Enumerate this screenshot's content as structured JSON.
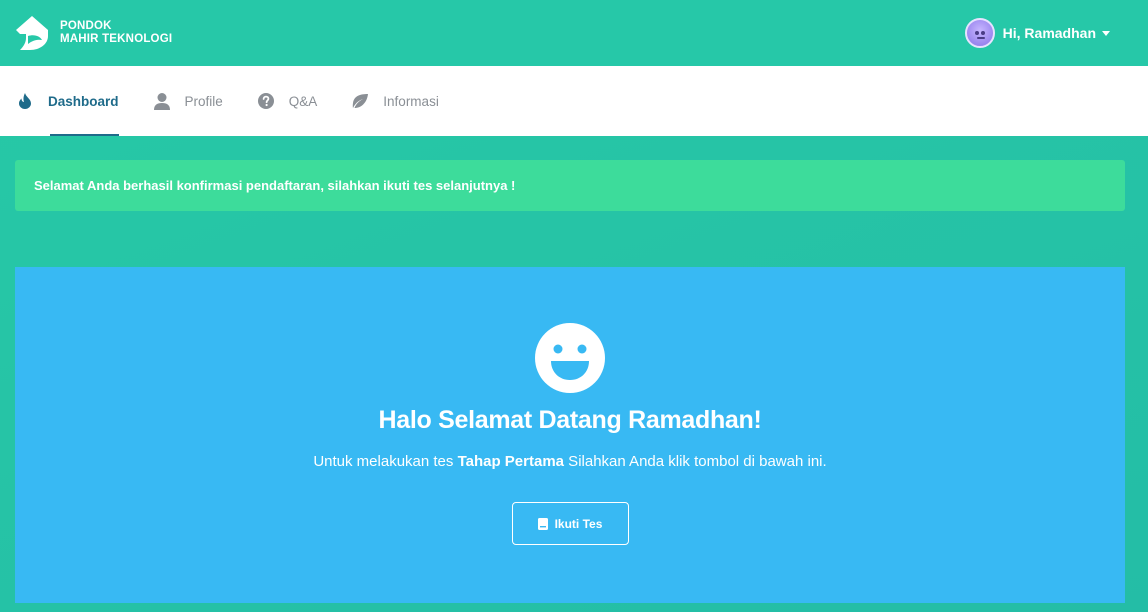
{
  "header": {
    "brand_line1": "PONDOK",
    "brand_line2": "MAHIR TEKNOLOGI",
    "logo_icon": "house-leaf-logo",
    "user_greeting": "Hi, Ramadhan",
    "avatar_icon": "user-avatar"
  },
  "nav": {
    "items": [
      {
        "label": "Dashboard",
        "icon": "fire-icon",
        "active": true
      },
      {
        "label": "Profile",
        "icon": "user-icon",
        "active": false
      },
      {
        "label": "Q&A",
        "icon": "question-circle-icon",
        "active": false
      },
      {
        "label": "Informasi",
        "icon": "leaf-icon",
        "active": false
      }
    ]
  },
  "alert": {
    "message": "Selamat Anda berhasil konfirmasi pendaftaran, silahkan ikuti tes selanjutnya !"
  },
  "card": {
    "icon": "smile-icon",
    "title": "Halo Selamat Datang Ramadhan!",
    "subtitle_prefix": "Untuk melakukan tes ",
    "subtitle_bold": "Tahap Pertama",
    "subtitle_suffix": " Silahkan Anda klik tombol di bawah ini.",
    "button_label": "Ikuti Tes",
    "button_icon": "book-icon"
  },
  "colors": {
    "header_bg": "#26c8a8",
    "alert_bg": "#3ddc9b",
    "card_bg": "#38b9f3",
    "nav_active": "#1f6b8a"
  }
}
